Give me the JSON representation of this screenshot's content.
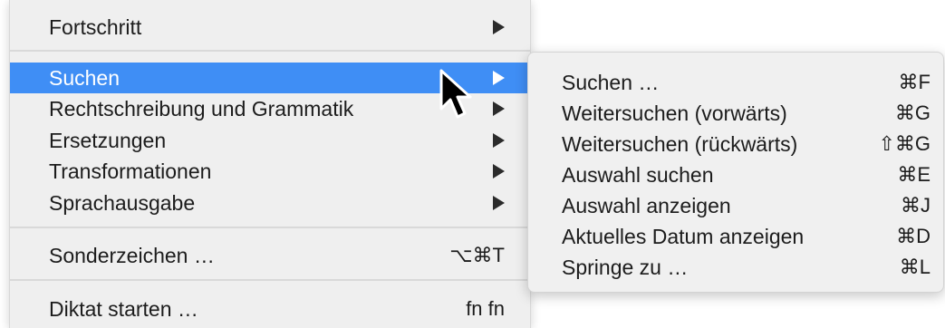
{
  "menu": {
    "items": [
      {
        "label": "Fortschritt",
        "submenu_icon": "triangle-right-icon"
      },
      {
        "label": "Suchen",
        "submenu_icon": "triangle-right-icon",
        "highlighted": true
      },
      {
        "label": "Rechtschreibung und Grammatik",
        "submenu_icon": "triangle-right-icon"
      },
      {
        "label": "Ersetzungen",
        "submenu_icon": "triangle-right-icon"
      },
      {
        "label": "Transformationen",
        "submenu_icon": "triangle-right-icon"
      },
      {
        "label": "Sprachausgabe",
        "submenu_icon": "triangle-right-icon"
      },
      {
        "label": "Sonderzeichen …",
        "shortcut": "⌥⌘T"
      },
      {
        "label": "Diktat starten …",
        "shortcut": "fn fn"
      }
    ]
  },
  "submenu": {
    "items": [
      {
        "label": "Suchen …",
        "shortcut": "⌘F"
      },
      {
        "label": "Weitersuchen (vorwärts)",
        "shortcut": "⌘G"
      },
      {
        "label": "Weitersuchen (rückwärts)",
        "shortcut": "⇧⌘G"
      },
      {
        "label": "Auswahl suchen",
        "shortcut": "⌘E"
      },
      {
        "label": "Auswahl anzeigen",
        "shortcut": "⌘J"
      },
      {
        "label": "Aktuelles Datum anzeigen",
        "shortcut": "⌘D"
      },
      {
        "label": "Springe zu …",
        "shortcut": "⌘L"
      }
    ]
  },
  "colors": {
    "highlight": "#3f8ef5",
    "menu_background": "#efefef",
    "text": "#1c1c1c"
  },
  "cursor_icon": "arrow-pointer-icon"
}
